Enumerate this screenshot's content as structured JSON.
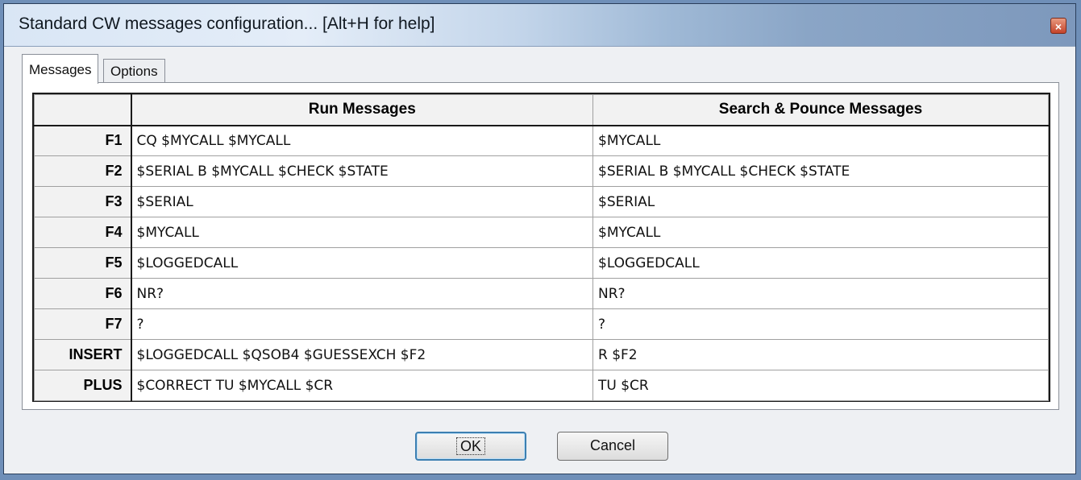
{
  "window": {
    "title": "Standard CW messages configuration... [Alt+H for help]",
    "close_label": "×"
  },
  "tabs": [
    {
      "label": "Messages",
      "active": true
    },
    {
      "label": "Options",
      "active": false
    }
  ],
  "grid": {
    "headers": [
      "",
      "Run Messages",
      "Search & Pounce Messages"
    ],
    "rows": [
      {
        "key": "F1",
        "run": "CQ $MYCALL $MYCALL",
        "sp": "$MYCALL"
      },
      {
        "key": "F2",
        "run": "$SERIAL B $MYCALL $CHECK $STATE",
        "sp": "$SERIAL B $MYCALL $CHECK $STATE"
      },
      {
        "key": "F3",
        "run": "$SERIAL",
        "sp": "$SERIAL"
      },
      {
        "key": "F4",
        "run": "$MYCALL",
        "sp": "$MYCALL"
      },
      {
        "key": "F5",
        "run": "$LOGGEDCALL",
        "sp": "$LOGGEDCALL"
      },
      {
        "key": "F6",
        "run": "NR?",
        "sp": "NR?"
      },
      {
        "key": "F7",
        "run": "?",
        "sp": "?"
      },
      {
        "key": "INSERT",
        "run": "$LOGGEDCALL $QSOB4 $GUESSEXCH $F2",
        "sp": "R $F2"
      },
      {
        "key": "PLUS",
        "run": "$CORRECT TU $MYCALL $CR",
        "sp": "TU $CR"
      }
    ]
  },
  "buttons": {
    "ok_label": "OK",
    "cancel_label": "Cancel"
  },
  "colors": {
    "accent": "#3c7fb1",
    "close": "#c4432a"
  }
}
